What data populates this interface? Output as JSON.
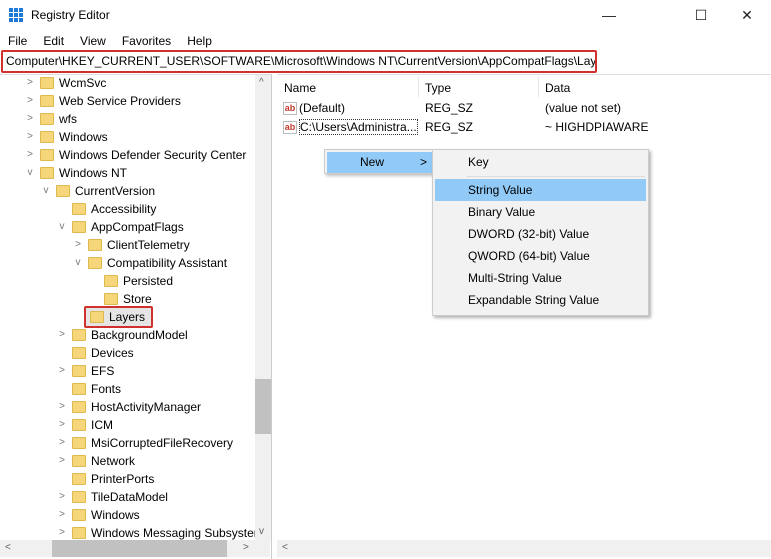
{
  "window": {
    "title": "Registry Editor",
    "minimize": "—",
    "maximize": "☐",
    "close": "✕"
  },
  "menu": [
    "File",
    "Edit",
    "View",
    "Favorites",
    "Help"
  ],
  "address": "Computer\\HKEY_CURRENT_USER\\SOFTWARE\\Microsoft\\Windows NT\\CurrentVersion\\AppCompatFlags\\Layers",
  "tree": [
    {
      "label": "WcmSvc",
      "level": 0,
      "exp": ">"
    },
    {
      "label": "Web Service Providers",
      "level": 0,
      "exp": ">"
    },
    {
      "label": "wfs",
      "level": 0,
      "exp": ">"
    },
    {
      "label": "Windows",
      "level": 0,
      "exp": ">"
    },
    {
      "label": "Windows Defender Security Center",
      "level": 0,
      "exp": ">"
    },
    {
      "label": "Windows NT",
      "level": 0,
      "exp": "v"
    },
    {
      "label": "CurrentVersion",
      "level": 1,
      "exp": "v"
    },
    {
      "label": "Accessibility",
      "level": 2,
      "exp": ""
    },
    {
      "label": "AppCompatFlags",
      "level": 2,
      "exp": "v"
    },
    {
      "label": "ClientTelemetry",
      "level": 3,
      "exp": ">"
    },
    {
      "label": "Compatibility Assistant",
      "level": 3,
      "exp": "v"
    },
    {
      "label": "Persisted",
      "level": 4,
      "exp": ""
    },
    {
      "label": "Store",
      "level": 4,
      "exp": ""
    },
    {
      "label": "Layers",
      "level": 3,
      "exp": "",
      "selected": true
    },
    {
      "label": "BackgroundModel",
      "level": 2,
      "exp": ">"
    },
    {
      "label": "Devices",
      "level": 2,
      "exp": ""
    },
    {
      "label": "EFS",
      "level": 2,
      "exp": ">"
    },
    {
      "label": "Fonts",
      "level": 2,
      "exp": ""
    },
    {
      "label": "HostActivityManager",
      "level": 2,
      "exp": ">"
    },
    {
      "label": "ICM",
      "level": 2,
      "exp": ">"
    },
    {
      "label": "MsiCorruptedFileRecovery",
      "level": 2,
      "exp": ">"
    },
    {
      "label": "Network",
      "level": 2,
      "exp": ">"
    },
    {
      "label": "PrinterPorts",
      "level": 2,
      "exp": ""
    },
    {
      "label": "TileDataModel",
      "level": 2,
      "exp": ">"
    },
    {
      "label": "Windows",
      "level": 2,
      "exp": ">"
    },
    {
      "label": "Windows Messaging Subsystem",
      "level": 2,
      "exp": ">"
    }
  ],
  "columns": {
    "name": "Name",
    "type": "Type",
    "data": "Data"
  },
  "values": [
    {
      "icon": "ab",
      "name": "(Default)",
      "type": "REG_SZ",
      "data": "(value not set)"
    },
    {
      "icon": "ab",
      "name": "C:\\Users\\Administra...",
      "type": "REG_SZ",
      "data": "~ HIGHDPIAWARE"
    }
  ],
  "context_menu": {
    "new": "New",
    "chev": ">"
  },
  "submenu": [
    "Key",
    "String Value",
    "Binary Value",
    "DWORD (32-bit) Value",
    "QWORD (64-bit) Value",
    "Multi-String Value",
    "Expandable String Value"
  ],
  "scroll": {
    "up": "^",
    "down": "v",
    "left": "<",
    "right": ">"
  }
}
